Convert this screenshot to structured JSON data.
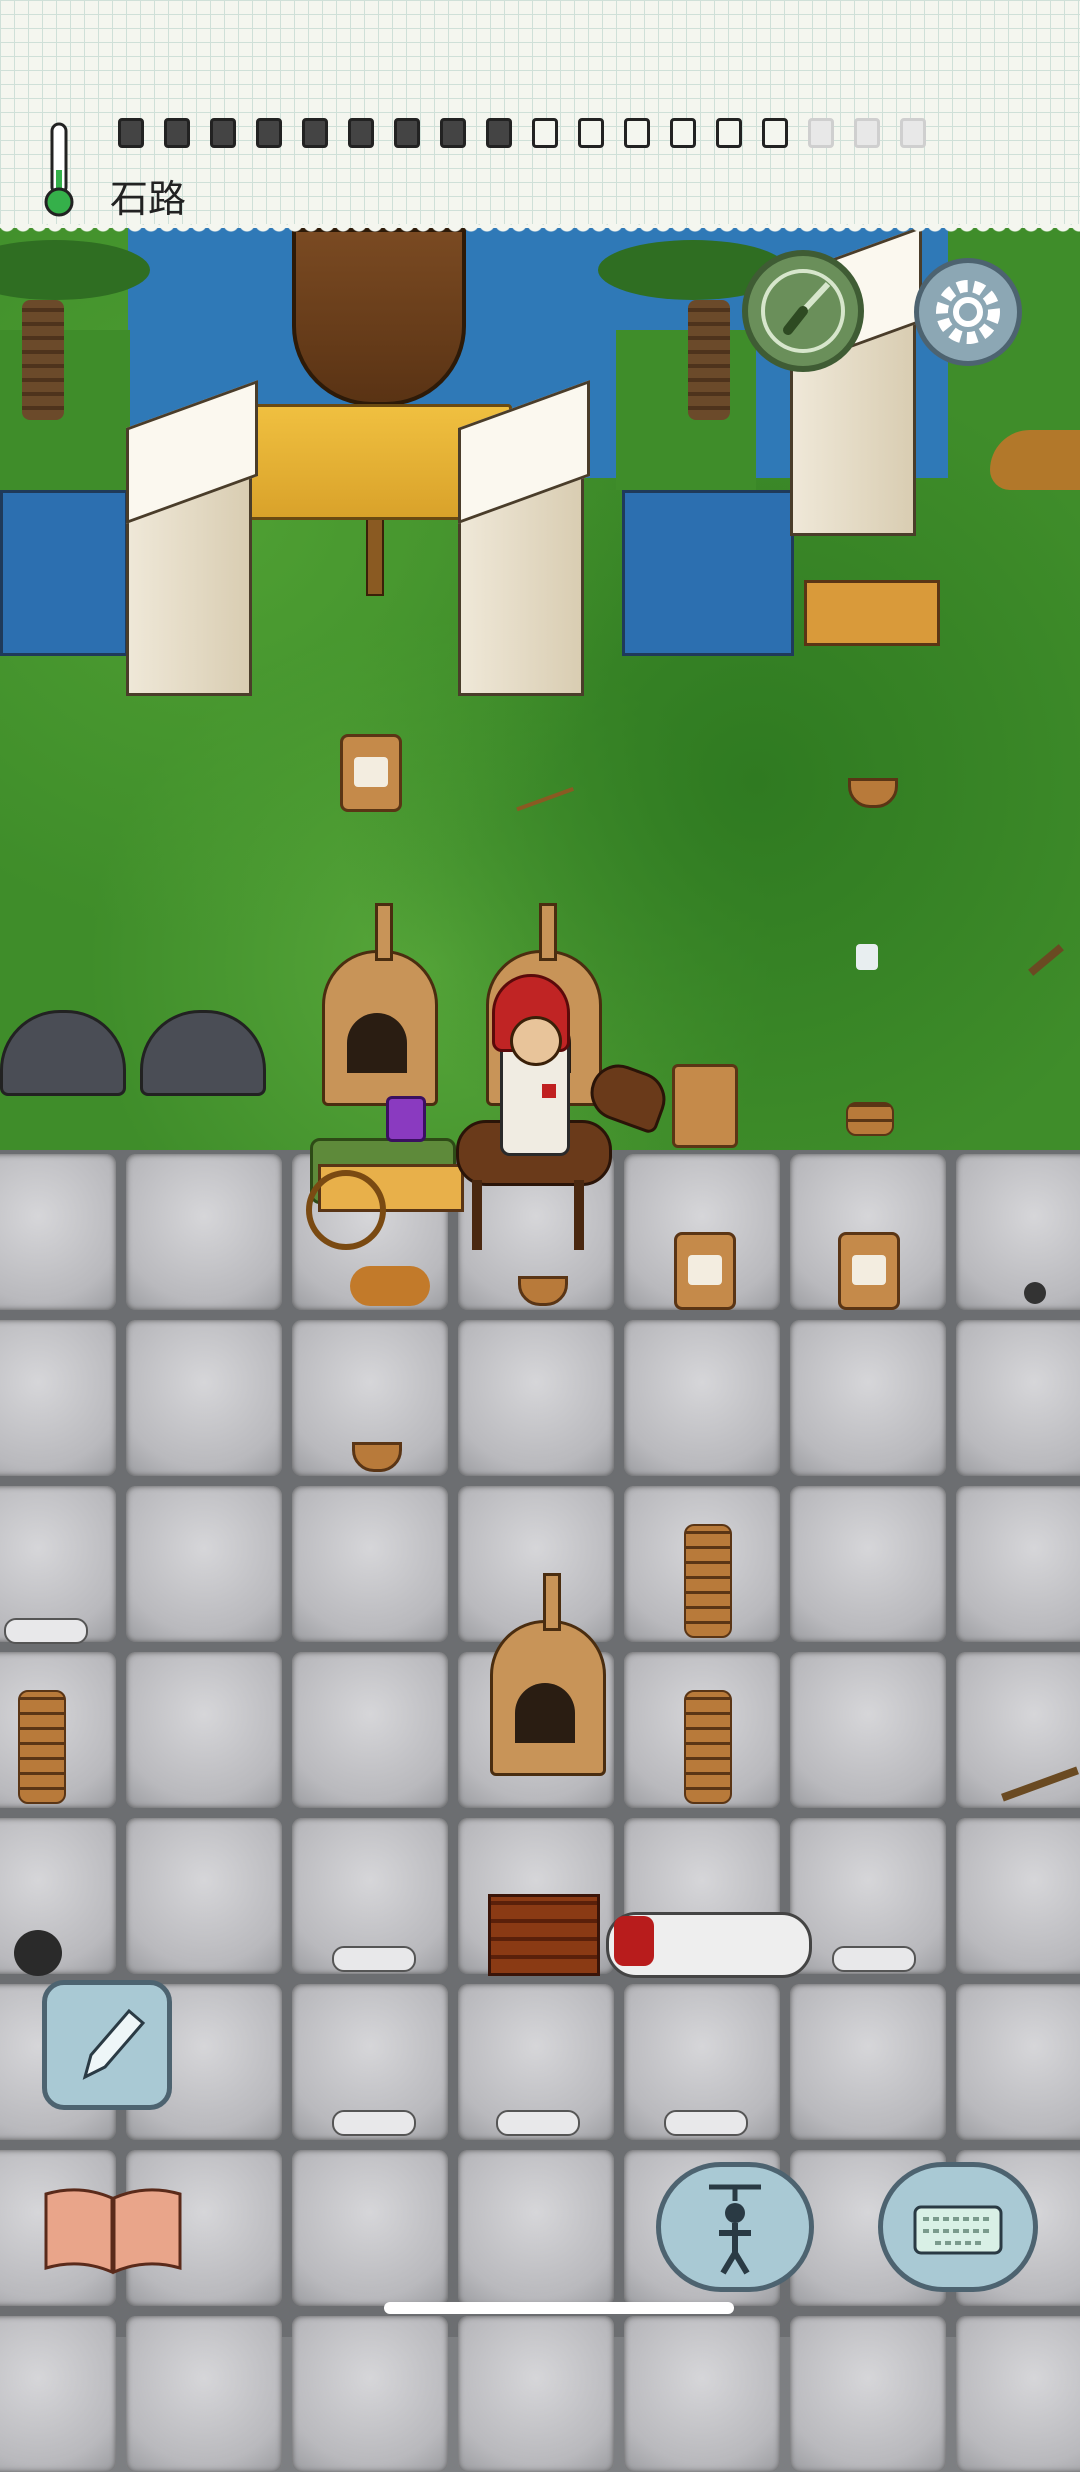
{
  "hud": {
    "biome_label": "石路",
    "food_pips": [
      "full",
      "full",
      "full",
      "full",
      "full",
      "full",
      "full",
      "full",
      "full",
      "empty",
      "empty",
      "empty",
      "empty",
      "empty",
      "empty",
      "faded",
      "faded",
      "faded"
    ]
  },
  "colors": {
    "grass": "#3f8d2a",
    "water": "#2f79b7",
    "stone_tile": "#c9c9cc",
    "ui_button": "#a9c9d4"
  },
  "icons": {
    "thermometer": "thermometer-icon",
    "compass": "compass-icon",
    "settings": "gear-icon",
    "note": "pencil-icon",
    "recipes": "book-icon",
    "emote": "puppet-icon",
    "chat": "keyboard-icon"
  }
}
